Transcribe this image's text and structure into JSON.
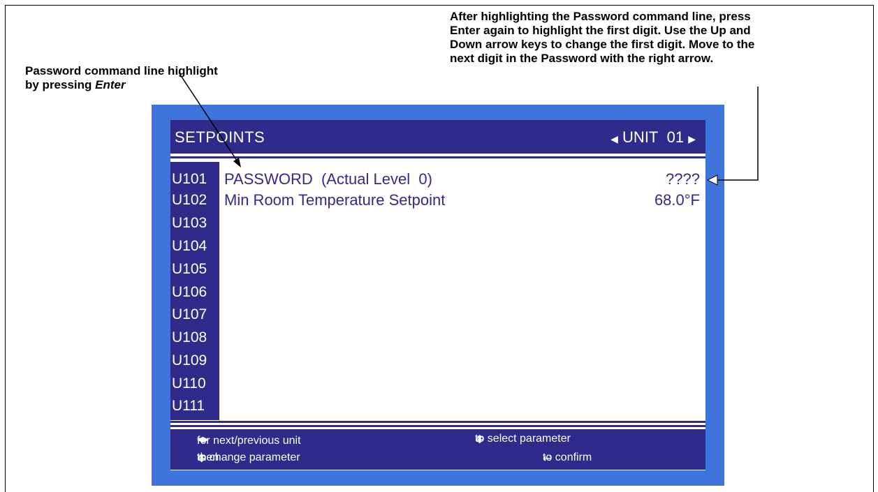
{
  "annotations": {
    "left_line1": "Password command line    highlight",
    "left_line2_prefix": "by pressing ",
    "left_line2_italic": "Enter",
    "right_lines": [
      "After highlighting the Password command line, press",
      "Enter again to highlight the first digit. Use the Up and",
      "Down arrow keys to change the first digit. Move to the",
      "next digit in the Password with the right arrow."
    ]
  },
  "display": {
    "title": "SETPOINTS",
    "unit_label": "UNIT",
    "unit_number": "01",
    "rows": [
      {
        "id": "U101",
        "name": "PASSWORD  (Actual Level  0)",
        "value": "????"
      },
      {
        "id": "U102",
        "name": "Min Room Temperature Setpoint",
        "value": "68.0°F"
      },
      {
        "id": "U103",
        "name": "",
        "value": ""
      },
      {
        "id": "U104",
        "name": "",
        "value": ""
      },
      {
        "id": "U105",
        "name": "",
        "value": ""
      },
      {
        "id": "U106",
        "name": "",
        "value": ""
      },
      {
        "id": "U107",
        "name": "",
        "value": ""
      },
      {
        "id": "U108",
        "name": "",
        "value": ""
      },
      {
        "id": "U109",
        "name": "",
        "value": ""
      },
      {
        "id": "U110",
        "name": "",
        "value": ""
      },
      {
        "id": "U111",
        "name": "",
        "value": ""
      }
    ],
    "footer": {
      "next_prev": "for next/previous unit",
      "change_then": "then",
      "change_text": "to change parameter",
      "select_text": "to select parameter",
      "confirm_text": "to confirm"
    }
  },
  "icons": {
    "left_arrow": "left-triangle-icon",
    "right_arrow": "right-triangle-icon",
    "enter": "enter-return-icon",
    "up_down": "up-down-icon"
  },
  "colors": {
    "bezel": "#3f74dd",
    "header": "#302b8a",
    "text": "#302b8a",
    "screen": "#ffffff"
  }
}
